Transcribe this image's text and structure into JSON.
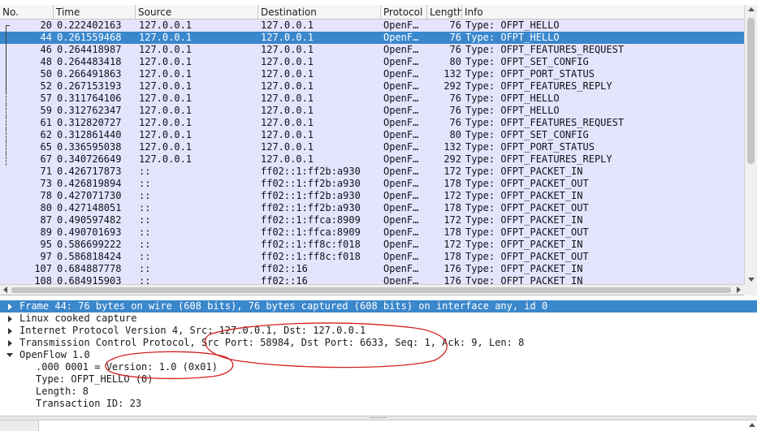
{
  "packet_list": {
    "columns": [
      "No.",
      "Time",
      "Source",
      "Destination",
      "Protocol",
      "Length",
      "Info"
    ],
    "selected_no": "44",
    "rows": [
      {
        "no": "20",
        "time": "0.222402163",
        "src": "127.0.0.1",
        "dst": "127.0.0.1",
        "proto": "OpenF…",
        "len": "76",
        "info": "Type: OFPT_HELLO"
      },
      {
        "no": "44",
        "time": "0.261559468",
        "src": "127.0.0.1",
        "dst": "127.0.0.1",
        "proto": "OpenF…",
        "len": "76",
        "info": "Type: OFPT_HELLO"
      },
      {
        "no": "46",
        "time": "0.264418987",
        "src": "127.0.0.1",
        "dst": "127.0.0.1",
        "proto": "OpenF…",
        "len": "76",
        "info": "Type: OFPT_FEATURES_REQUEST"
      },
      {
        "no": "48",
        "time": "0.264483418",
        "src": "127.0.0.1",
        "dst": "127.0.0.1",
        "proto": "OpenF…",
        "len": "80",
        "info": "Type: OFPT_SET_CONFIG"
      },
      {
        "no": "50",
        "time": "0.266491863",
        "src": "127.0.0.1",
        "dst": "127.0.0.1",
        "proto": "OpenF…",
        "len": "132",
        "info": "Type: OFPT_PORT_STATUS"
      },
      {
        "no": "52",
        "time": "0.267153193",
        "src": "127.0.0.1",
        "dst": "127.0.0.1",
        "proto": "OpenF…",
        "len": "292",
        "info": "Type: OFPT_FEATURES_REPLY"
      },
      {
        "no": "57",
        "time": "0.311764106",
        "src": "127.0.0.1",
        "dst": "127.0.0.1",
        "proto": "OpenF…",
        "len": "76",
        "info": "Type: OFPT_HELLO"
      },
      {
        "no": "59",
        "time": "0.312762347",
        "src": "127.0.0.1",
        "dst": "127.0.0.1",
        "proto": "OpenF…",
        "len": "76",
        "info": "Type: OFPT_HELLO"
      },
      {
        "no": "61",
        "time": "0.312820727",
        "src": "127.0.0.1",
        "dst": "127.0.0.1",
        "proto": "OpenF…",
        "len": "76",
        "info": "Type: OFPT_FEATURES_REQUEST"
      },
      {
        "no": "62",
        "time": "0.312861440",
        "src": "127.0.0.1",
        "dst": "127.0.0.1",
        "proto": "OpenF…",
        "len": "80",
        "info": "Type: OFPT_SET_CONFIG"
      },
      {
        "no": "65",
        "time": "0.336595038",
        "src": "127.0.0.1",
        "dst": "127.0.0.1",
        "proto": "OpenF…",
        "len": "132",
        "info": "Type: OFPT_PORT_STATUS"
      },
      {
        "no": "67",
        "time": "0.340726649",
        "src": "127.0.0.1",
        "dst": "127.0.0.1",
        "proto": "OpenF…",
        "len": "292",
        "info": "Type: OFPT_FEATURES_REPLY"
      },
      {
        "no": "71",
        "time": "0.426717873",
        "src": "::",
        "dst": "ff02::1:ff2b:a930",
        "proto": "OpenF…",
        "len": "172",
        "info": "Type: OFPT_PACKET_IN"
      },
      {
        "no": "73",
        "time": "0.426819894",
        "src": "::",
        "dst": "ff02::1:ff2b:a930",
        "proto": "OpenF…",
        "len": "178",
        "info": "Type: OFPT_PACKET_OUT"
      },
      {
        "no": "78",
        "time": "0.427071730",
        "src": "::",
        "dst": "ff02::1:ff2b:a930",
        "proto": "OpenF…",
        "len": "172",
        "info": "Type: OFPT_PACKET_IN"
      },
      {
        "no": "80",
        "time": "0.427148051",
        "src": "::",
        "dst": "ff02::1:ff2b:a930",
        "proto": "OpenF…",
        "len": "178",
        "info": "Type: OFPT_PACKET_OUT"
      },
      {
        "no": "87",
        "time": "0.490597482",
        "src": "::",
        "dst": "ff02::1:ffca:8909",
        "proto": "OpenF…",
        "len": "172",
        "info": "Type: OFPT_PACKET_IN"
      },
      {
        "no": "89",
        "time": "0.490701693",
        "src": "::",
        "dst": "ff02::1:ffca:8909",
        "proto": "OpenF…",
        "len": "178",
        "info": "Type: OFPT_PACKET_OUT"
      },
      {
        "no": "95",
        "time": "0.586699222",
        "src": "::",
        "dst": "ff02::1:ff8c:f018",
        "proto": "OpenF…",
        "len": "172",
        "info": "Type: OFPT_PACKET_IN"
      },
      {
        "no": "97",
        "time": "0.586818424",
        "src": "::",
        "dst": "ff02::1:ff8c:f018",
        "proto": "OpenF…",
        "len": "178",
        "info": "Type: OFPT_PACKET_OUT"
      },
      {
        "no": "107",
        "time": "0.684887778",
        "src": "::",
        "dst": "ff02::16",
        "proto": "OpenF…",
        "len": "176",
        "info": "Type: OFPT_PACKET_IN"
      },
      {
        "no": "108",
        "time": "0.684915903",
        "src": "::",
        "dst": "ff02::16",
        "proto": "OpenF…",
        "len": "176",
        "info": "Type: OFPT_PACKET_IN"
      }
    ]
  },
  "details": {
    "items": [
      {
        "text": "Frame 44: 76 bytes on wire (608 bits), 76 bytes captured (608 bits) on interface any, id 0",
        "level": 0,
        "toggle": "collapsed",
        "selected": true
      },
      {
        "text": "Linux cooked capture",
        "level": 0,
        "toggle": "collapsed",
        "selected": false
      },
      {
        "text": "Internet Protocol Version 4, Src: 127.0.0.1, Dst: 127.0.0.1",
        "level": 0,
        "toggle": "collapsed",
        "selected": false
      },
      {
        "text": "Transmission Control Protocol, Src Port: 58984, Dst Port: 6633, Seq: 1, Ack: 9, Len: 8",
        "level": 0,
        "toggle": "collapsed",
        "selected": false
      },
      {
        "text": "OpenFlow 1.0",
        "level": 0,
        "toggle": "expanded",
        "selected": false
      },
      {
        "text": ".000 0001 = Version: 1.0 (0x01)",
        "level": 1,
        "toggle": "none",
        "selected": false
      },
      {
        "text": "Type: OFPT_HELLO (0)",
        "level": 1,
        "toggle": "none",
        "selected": false
      },
      {
        "text": "Length: 8",
        "level": 1,
        "toggle": "none",
        "selected": false
      },
      {
        "text": "Transaction ID: 23",
        "level": 1,
        "toggle": "none",
        "selected": false
      }
    ]
  },
  "colors": {
    "row_background": "#e4e4fc",
    "selection": "#3a87cc",
    "annotation": "#d42020"
  }
}
